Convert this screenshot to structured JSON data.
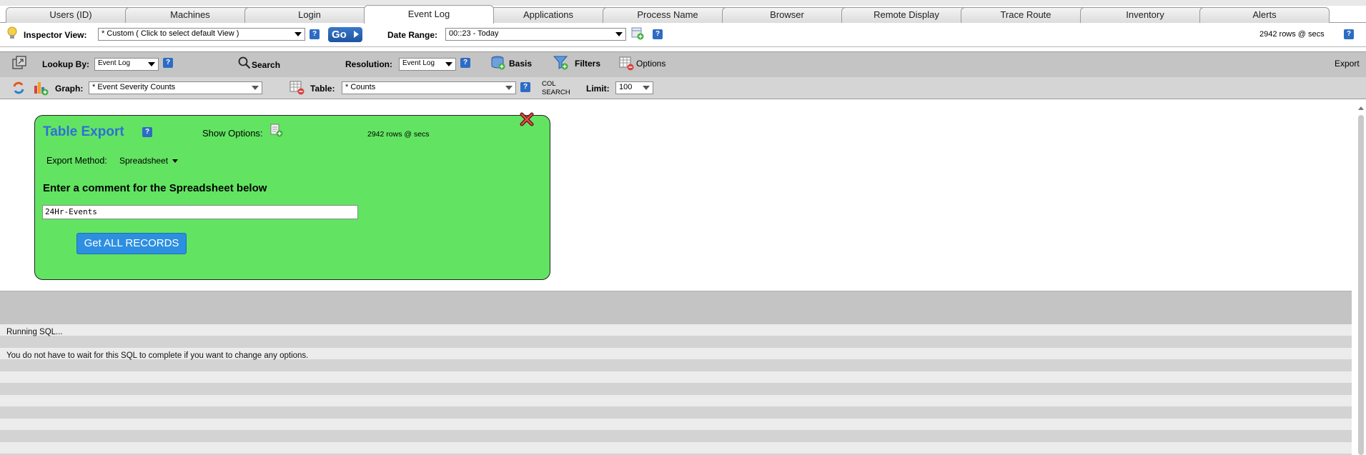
{
  "tabs": [
    "Users (ID)",
    "Machines",
    "Login",
    "Event Log",
    "Applications",
    "Process Name",
    "Browser",
    "Remote Display",
    "Trace Route",
    "Inventory",
    "Alerts"
  ],
  "active_tab": "Event Log",
  "inspector": {
    "label": "Inspector View:",
    "view_value": "* Custom ( Click to select default View )",
    "go_label": "Go",
    "date_label": "Date Range:",
    "date_value": "00::23 - Today",
    "rows_status": "2942 rows @  secs"
  },
  "toolbar": {
    "lookup_label": "Lookup By:",
    "lookup_value": "Event Log",
    "search_label": "Search",
    "resolution_label": "Resolution:",
    "resolution_value": "Event Log",
    "basis_label": "Basis",
    "filters_label": "Filters",
    "options_label": "Options",
    "export_label": "Export",
    "graph_label": "Graph:",
    "graph_value": "* Event Severity Counts",
    "table_label": "Table:",
    "table_value": "* Counts",
    "col_label": "COL",
    "col_search_label": "SEARCH",
    "limit_label": "Limit:",
    "limit_value": "100"
  },
  "dialog": {
    "title": "Table Export",
    "show_options_label": "Show Options:",
    "rows_status": "2942 rows @  secs",
    "export_method_label": "Export Method:",
    "export_method_value": "Spreadsheet",
    "comment_heading": "Enter a comment for the Spreadsheet below",
    "comment_value": "24Hr-Events",
    "get_all_label": "Get ALL RECORDS"
  },
  "messages": {
    "running": "Running SQL...",
    "no_wait": "You do not have to wait for this SQL to complete if you want to change any options."
  },
  "colors": {
    "dialog_bg": "#62e462",
    "title_blue": "#2f6fd8",
    "button_blue": "#2d8fe0",
    "toolbar_gray": "#c4c4c4"
  }
}
